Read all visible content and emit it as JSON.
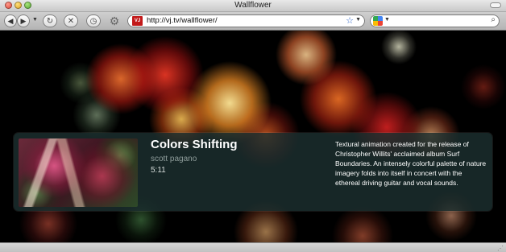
{
  "window": {
    "title": "Wallflower"
  },
  "toolbar": {
    "url": "http://vj.tv/wallflower/",
    "favicon_text": "VJ",
    "icons": {
      "back": "back-arrow-icon",
      "forward": "forward-arrow-icon",
      "reload": "reload-icon",
      "stop": "stop-icon",
      "history": "history-clock-icon",
      "settings": "gear-icon",
      "bookmark": "star-icon",
      "search": "magnifier-icon"
    }
  },
  "video": {
    "title": "Colors Shifting",
    "author": "scott pagano",
    "duration": "5:11",
    "description": "Textural animation created for the release of Christopher Willits' acclaimed album Surf Boundaries.  An intensely colorful palette of nature imagery folds into itself in concert with the ethereal driving guitar and vocal sounds."
  }
}
